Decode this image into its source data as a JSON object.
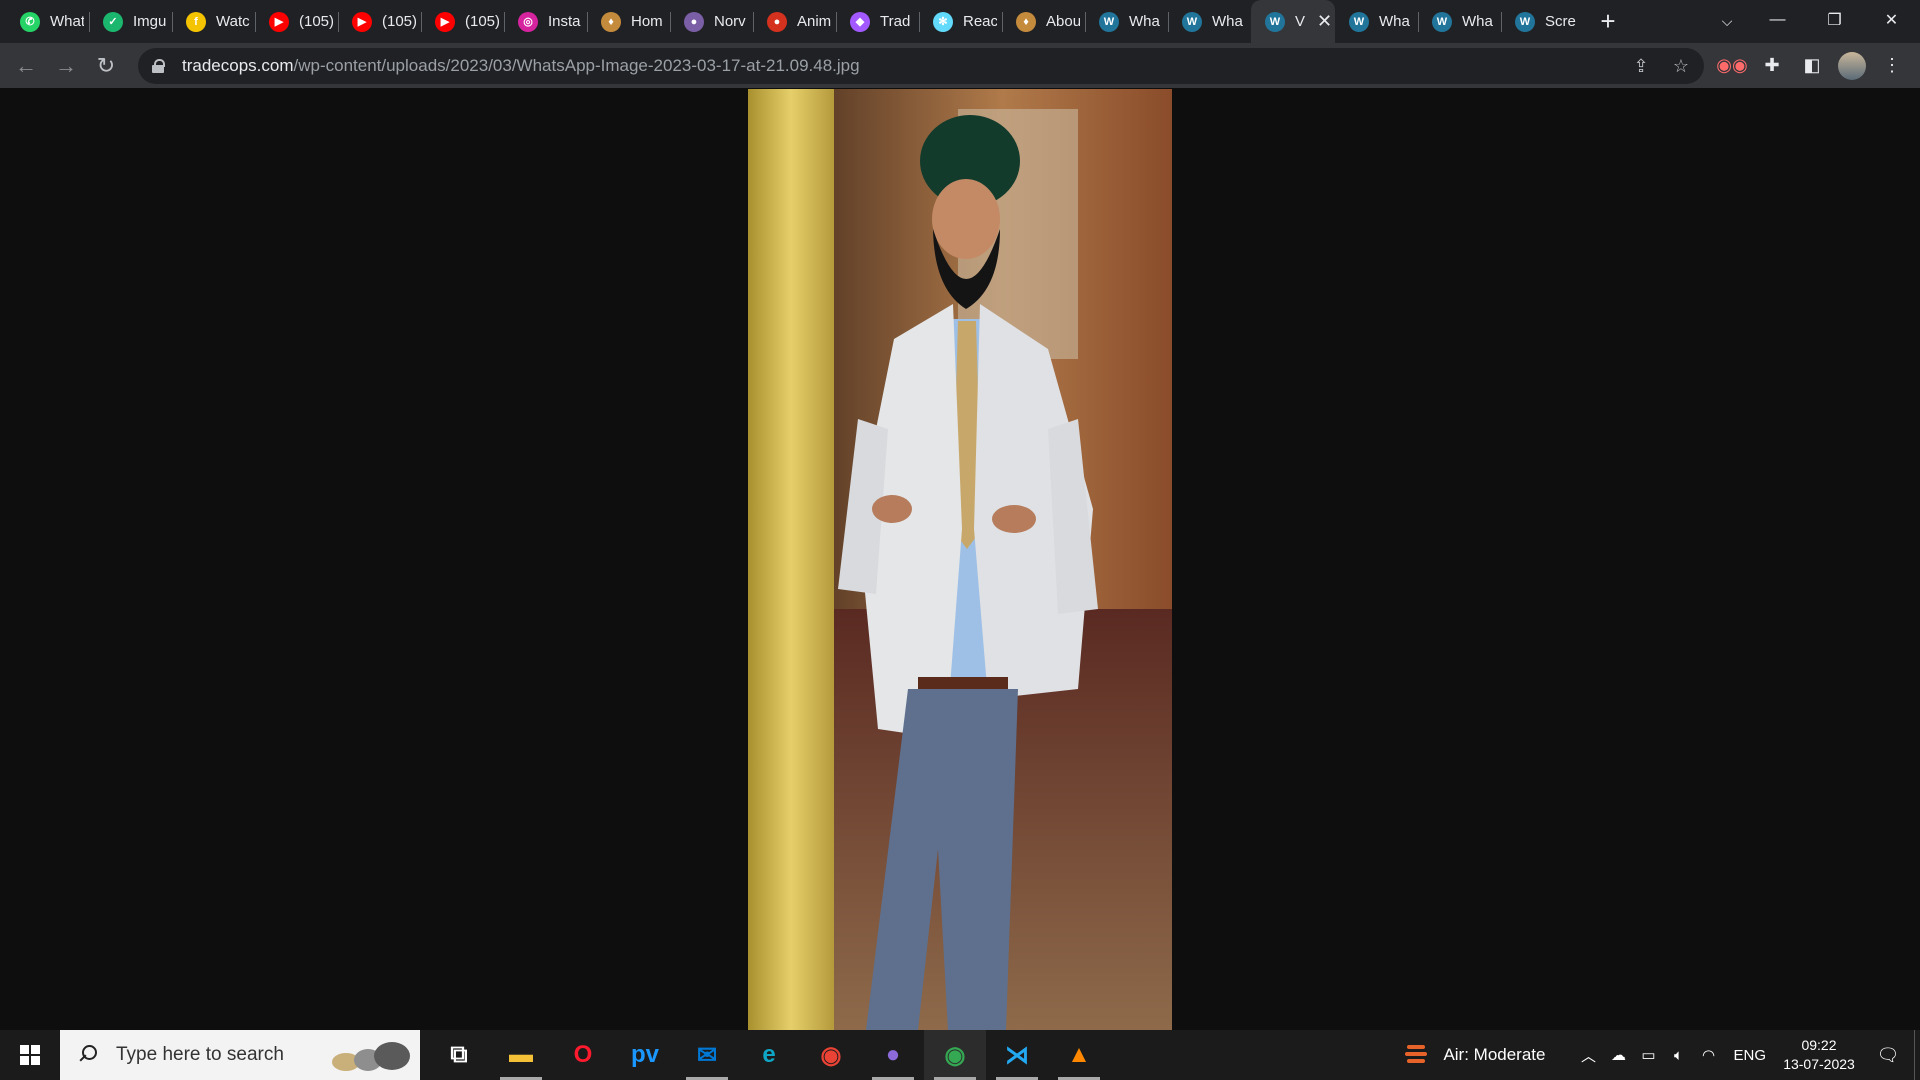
{
  "browser": {
    "tabs": [
      {
        "label": "What",
        "favicon": "whatsapp-icon",
        "color": "#25d366",
        "glyph": "✆"
      },
      {
        "label": "Imgu",
        "favicon": "imgur-icon",
        "color": "#1bb76e",
        "glyph": "✓"
      },
      {
        "label": "Watc",
        "favicon": "circle-f-icon",
        "color": "#f5c400",
        "glyph": "f"
      },
      {
        "label": "(105)",
        "favicon": "youtube-icon",
        "color": "#ff0000",
        "glyph": "▶"
      },
      {
        "label": "(105)",
        "favicon": "youtube-icon",
        "color": "#ff0000",
        "glyph": "▶"
      },
      {
        "label": "(105)",
        "favicon": "youtube-icon",
        "color": "#ff0000",
        "glyph": "▶"
      },
      {
        "label": "Insta",
        "favicon": "instagram-icon",
        "color": "#d6249f",
        "glyph": "◎"
      },
      {
        "label": "Hom",
        "favicon": "flame-icon",
        "color": "#c58b3c",
        "glyph": "♦"
      },
      {
        "label": "Norv",
        "favicon": "norv-icon",
        "color": "#7b5fa6",
        "glyph": "●"
      },
      {
        "label": "Anim",
        "favicon": "anim-icon",
        "color": "#d4321e",
        "glyph": "●"
      },
      {
        "label": "Trad",
        "favicon": "figma-icon",
        "color": "#a259ff",
        "glyph": "◆"
      },
      {
        "label": "Reac",
        "favicon": "react-icon",
        "color": "#61dafb",
        "glyph": "✻"
      },
      {
        "label": "Abou",
        "favicon": "flame-icon",
        "color": "#c58b3c",
        "glyph": "♦"
      },
      {
        "label": "Wha",
        "favicon": "wordpress-icon",
        "color": "#21759b",
        "glyph": "W"
      },
      {
        "label": "Wha",
        "favicon": "wordpress-icon",
        "color": "#21759b",
        "glyph": "W"
      },
      {
        "label": "V",
        "favicon": "wordpress-icon",
        "color": "#21759b",
        "glyph": "W",
        "active": true
      },
      {
        "label": "Wha",
        "favicon": "wordpress-icon",
        "color": "#21759b",
        "glyph": "W"
      },
      {
        "label": "Wha",
        "favicon": "wordpress-icon",
        "color": "#21759b",
        "glyph": "W"
      },
      {
        "label": "Scre",
        "favicon": "wordpress-icon",
        "color": "#21759b",
        "glyph": "W"
      }
    ],
    "new_tab": "+",
    "url_host": "tradecops.com",
    "url_path": "/wp-content/uploads/2023/03/WhatsApp-Image-2023-03-17-at-21.09.48.jpg"
  },
  "taskbar": {
    "search_placeholder": "Type here to search",
    "apps": [
      {
        "name": "task-view-icon",
        "glyph": "⧉",
        "color": "#ffffff"
      },
      {
        "name": "file-explorer-icon",
        "glyph": "▬",
        "color": "#f3c038",
        "running": true
      },
      {
        "name": "opera-icon",
        "glyph": "O",
        "color": "#ff1b2d"
      },
      {
        "name": "prime-video-icon",
        "glyph": "pv",
        "color": "#1a98ff"
      },
      {
        "name": "mail-icon",
        "glyph": "✉",
        "color": "#0078d4",
        "running": true
      },
      {
        "name": "edge-icon",
        "glyph": "e",
        "color": "#0fa5c4"
      },
      {
        "name": "chrome-icon",
        "glyph": "◉",
        "color": "#ea4335"
      },
      {
        "name": "discord-icon",
        "glyph": "●",
        "color": "#8c6ad9",
        "running": true
      },
      {
        "name": "chrome-profile-icon",
        "glyph": "◉",
        "color": "#34a853",
        "running": true,
        "active": true
      },
      {
        "name": "vscode-icon",
        "glyph": "⋊",
        "color": "#23a9f2",
        "running": true
      },
      {
        "name": "vlc-icon",
        "glyph": "▲",
        "color": "#ff8800",
        "running": true
      }
    ],
    "air_quality": "Air: Moderate",
    "language": "ENG",
    "time": "09:22",
    "date": "13-07-2023"
  }
}
